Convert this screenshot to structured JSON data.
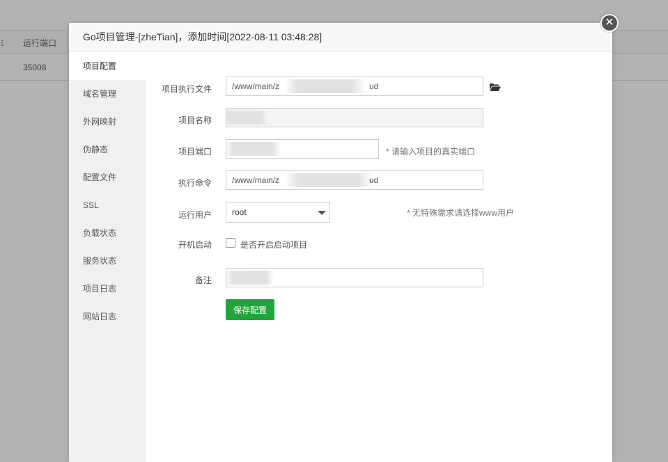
{
  "background": {
    "table_header_edge": "ﾐ",
    "table_header_port": "运行端口",
    "table_row_port": "35008"
  },
  "modal": {
    "title": "Go项目管理-[zheTian]，添加时间[2022-08-11 03:48:28]",
    "close_icon": "close-icon"
  },
  "sidebar": {
    "items": [
      {
        "label": "项目配置"
      },
      {
        "label": "域名管理"
      },
      {
        "label": "外网映射"
      },
      {
        "label": "伪静态"
      },
      {
        "label": "配置文件"
      },
      {
        "label": "SSL"
      },
      {
        "label": "负载状态"
      },
      {
        "label": "服务状态"
      },
      {
        "label": "项目日志"
      },
      {
        "label": "网站日志"
      }
    ]
  },
  "form": {
    "exec_file": {
      "label": "项目执行文件",
      "value_prefix": "/www/main/z",
      "value_suffix": "ud"
    },
    "project_name": {
      "label": "项目名称"
    },
    "project_port": {
      "label": "项目端口",
      "hint": "* 请输入项目的真实端口"
    },
    "exec_command": {
      "label": "执行命令",
      "value_prefix": "/www/main/z",
      "value_suffix": "ud"
    },
    "run_user": {
      "label": "运行用户",
      "value": "root",
      "hint": "* 无特殊需求请选择www用户"
    },
    "autostart": {
      "label": "开机启动",
      "checkbox_label": "是否开启启动项目",
      "checked": false
    },
    "remark": {
      "label": "备注"
    },
    "save_label": "保存配置"
  },
  "colors": {
    "accent": "#20a53a",
    "sidebar_bg": "#f0f0f0"
  }
}
